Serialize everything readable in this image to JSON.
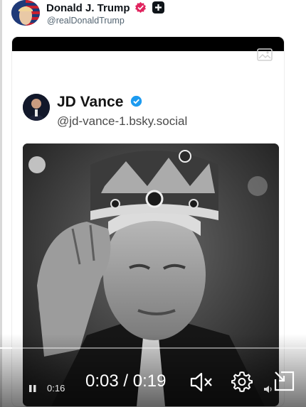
{
  "post": {
    "author_name": "Donald J. Trump",
    "author_handle": "@realDonaldTrump"
  },
  "embedded": {
    "name": "JD Vance",
    "handle": "@jd-vance-1.bsky.social"
  },
  "video": {
    "progress": 0.04,
    "elapsed_small": "0:16",
    "time_display": "0:03 / 0:19"
  },
  "icons": {
    "verified_post": "verified-badge-icon",
    "plus": "plus-badge-icon",
    "image": "image-icon",
    "verified_embedded": "verified-check-icon",
    "pause": "pause-icon",
    "mute": "speaker-muted-icon",
    "settings": "gear-icon",
    "volume": "speaker-icon",
    "pip": "picture-in-picture-icon"
  },
  "colors": {
    "verified_pink": "#e0245e",
    "verified_blue": "#1d9bf0",
    "text": "#0f1419",
    "muted_text": "#536471"
  }
}
